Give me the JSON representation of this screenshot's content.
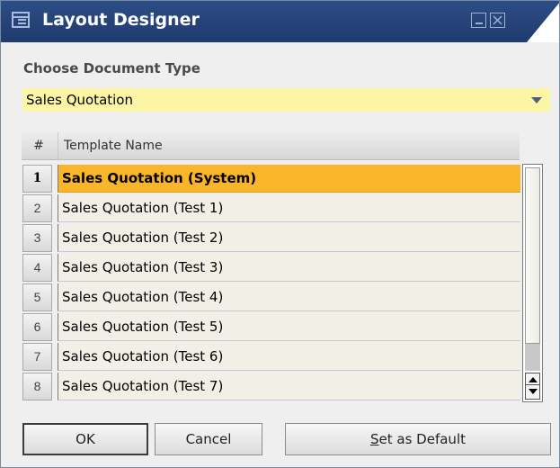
{
  "window": {
    "title": "Layout Designer",
    "title_bar_color": "#1f3b6e"
  },
  "document_type": {
    "label": "Choose Document Type",
    "selected": "Sales Quotation",
    "field_color": "#fdf5a6"
  },
  "grid": {
    "columns": [
      "#",
      "Template Name"
    ],
    "rows": [
      {
        "num": "1",
        "name": "Sales Quotation (System)",
        "selected": true
      },
      {
        "num": "2",
        "name": "Sales Quotation (Test 1)"
      },
      {
        "num": "3",
        "name": "Sales Quotation (Test 2)"
      },
      {
        "num": "4",
        "name": "Sales Quotation (Test 3)"
      },
      {
        "num": "5",
        "name": "Sales Quotation (Test 4)"
      },
      {
        "num": "6",
        "name": "Sales Quotation (Test 5)"
      },
      {
        "num": "7",
        "name": "Sales Quotation (Test 6)"
      },
      {
        "num": "8",
        "name": "Sales Quotation (Test 7)"
      }
    ],
    "selected_color": "#fab52a"
  },
  "buttons": {
    "ok": "OK",
    "cancel": "Cancel",
    "set_default_first": "S",
    "set_default_rest": "et as Default"
  }
}
